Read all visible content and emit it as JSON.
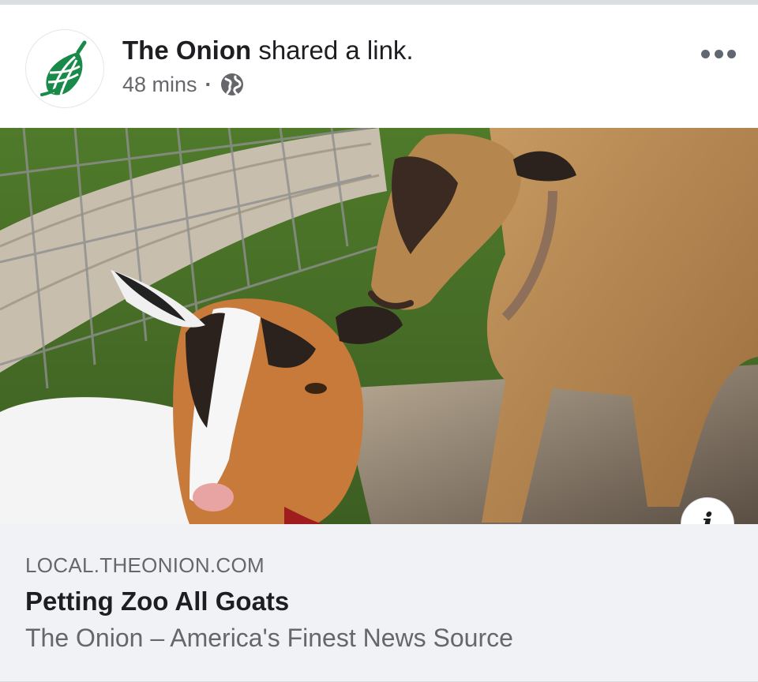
{
  "post": {
    "author": "The Onion",
    "action": "shared a link.",
    "time": "48 mins",
    "separator": "·",
    "audience_icon": "globe-icon",
    "more_icon": "more-options-icon",
    "avatar_icon": "onion-logo-icon"
  },
  "link": {
    "domain": "LOCAL.THEONION.COM",
    "title": "Petting Zoo All Goats",
    "description": "The Onion – America's Finest News Source",
    "info_label": "i"
  },
  "colors": {
    "brand_green": "#1a8a4a",
    "secondary_text": "#65676b",
    "link_background": "#f0f2f5"
  }
}
